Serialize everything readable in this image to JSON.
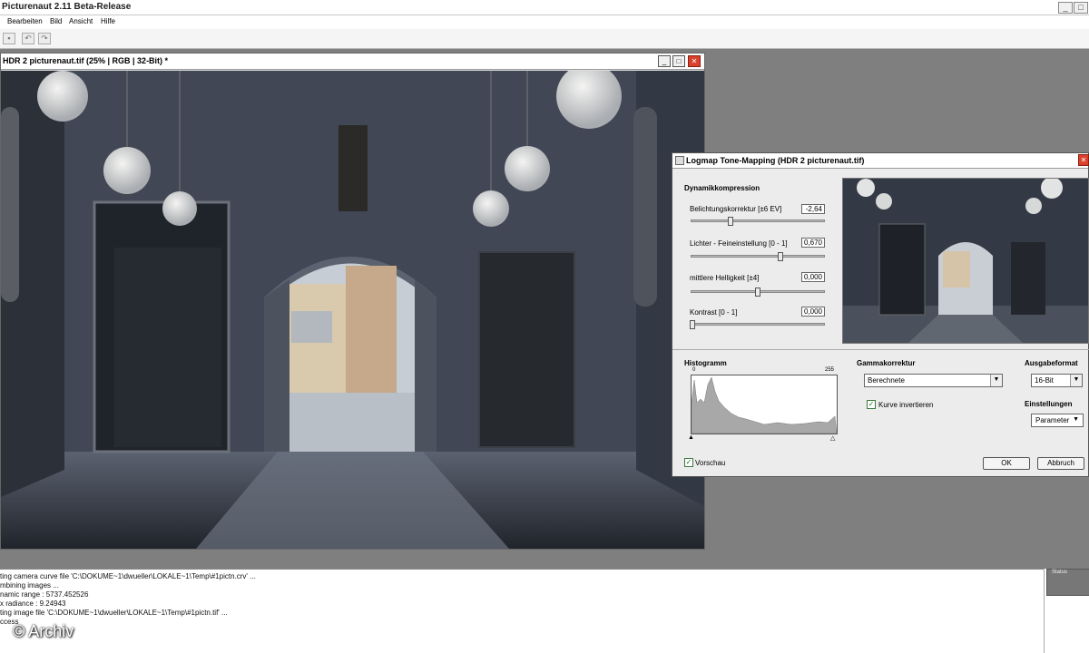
{
  "app": {
    "title": "Picturenaut 2.11 Beta-Release",
    "minimize": "_",
    "maximize": "□",
    "close": "✕"
  },
  "menu": [
    "Bearbeiten",
    "Bild",
    "Ansicht",
    "Hilfe"
  ],
  "image_window": {
    "title": "HDR 2 picturenaut.tif (25% | RGB | 32-Bit) *"
  },
  "dialog": {
    "title": "Logmap Tone-Mapping (HDR 2 picturenaut.tif)",
    "section_dynamics": "Dynamikkompression",
    "params": [
      {
        "label": "Belichtungskorrektur [±6 EV]",
        "value": "-2,64",
        "position": 0.28
      },
      {
        "label": "Lichter - Feineinstellung [0 - 1]",
        "value": "0,670",
        "position": 0.67
      },
      {
        "label": "mittlere Helligkeit [±4]",
        "value": "0,000",
        "position": 0.5
      },
      {
        "label": "Kontrast [0 - 1]",
        "value": "0,000",
        "position": 0.0
      }
    ],
    "histogram_label": "Histogramm",
    "hist_min": "0",
    "hist_max": "255",
    "gamma_label": "Gammakorrektur",
    "gamma_value": "Berechnete",
    "invert_label": "Kurve invertieren",
    "output_label": "Ausgabeformat",
    "output_value": "16-Bit",
    "settings_label": "Einstellungen",
    "settings_value": "Parameter",
    "preview_label": "Vorschau",
    "ok": "OK",
    "cancel": "Abbruch"
  },
  "log": [
    "ting camera curve file 'C:\\DOKUME~1\\dwueller\\LOKALE~1\\Temp\\#1pictn.crv' ...",
    "mbining images ...",
    "namic range : 5737.452526",
    "x radiance : 9.24943",
    "ting image file 'C:\\DOKUME~1\\dwueller\\LOKALE~1\\Temp\\#1pictn.tif' ...",
    "ccess"
  ],
  "status_panel_label": "Status",
  "watermark": "© Archiv"
}
